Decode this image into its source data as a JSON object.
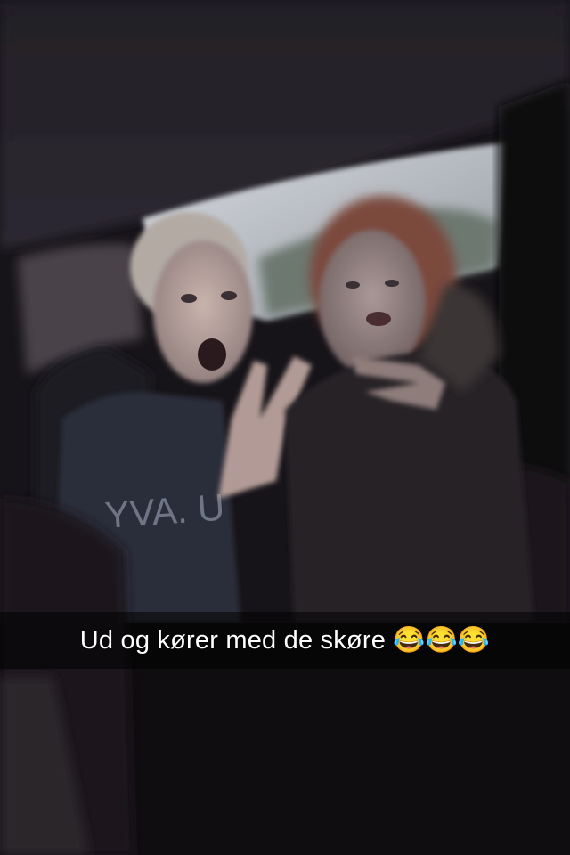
{
  "caption": {
    "text": "Ud og kører med de skøre 😂😂😂"
  },
  "colors": {
    "caption_bar": "#000000",
    "caption_text": "#ffffff"
  }
}
